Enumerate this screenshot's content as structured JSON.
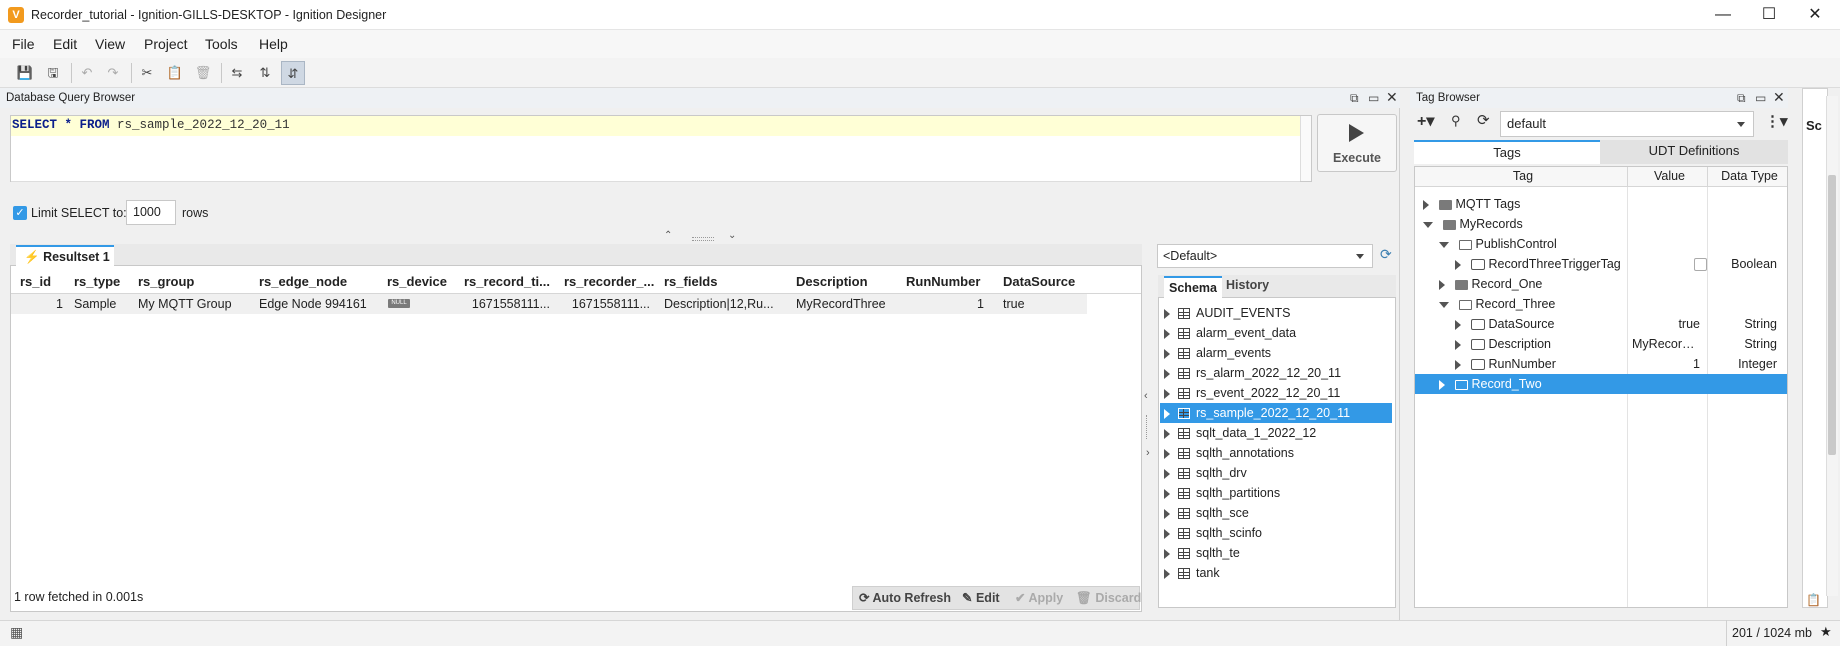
{
  "window": {
    "title": "Recorder_tutorial - Ignition-GILLS-DESKTOP - Ignition Designer",
    "app_icon": "V"
  },
  "menu": [
    "File",
    "Edit",
    "View",
    "Project",
    "Tools",
    "Help"
  ],
  "query_panel": {
    "title": "Database Query Browser",
    "sql_keyword1": "SELECT",
    "sql_star": " * ",
    "sql_keyword2": "FROM",
    "sql_table": " rs_sample_2022_12_20_11",
    "execute_label": "Execute",
    "limit_label": "Limit SELECT to:",
    "limit_value": "1000",
    "rows_label": "rows",
    "resultset_tab": "Resultset 1",
    "columns": [
      "rs_id",
      "rs_type",
      "rs_group",
      "rs_edge_node",
      "rs_device",
      "rs_record_ti...",
      "rs_recorder_...",
      "rs_fields",
      "Description",
      "RunNumber",
      "DataSource"
    ],
    "rows": [
      [
        "1",
        "Sample",
        "My MQTT Group",
        "Edge Node 994161",
        "NULL",
        "1671558111...",
        "1671558111...",
        "Description|12,Ru...",
        "MyRecordThree",
        "1",
        "true"
      ]
    ],
    "status": "1 row fetched in 0.001s",
    "auto_refresh": "Auto Refresh",
    "edit": "Edit",
    "apply": "Apply",
    "discard": "Discard"
  },
  "schema_panel": {
    "datasource": "<Default>",
    "tabs": [
      "Schema",
      "History"
    ],
    "tables": [
      "AUDIT_EVENTS",
      "alarm_event_data",
      "alarm_events",
      "rs_alarm_2022_12_20_11",
      "rs_event_2022_12_20_11",
      "rs_sample_2022_12_20_11",
      "sqlt_data_1_2022_12",
      "sqlth_annotations",
      "sqlth_drv",
      "sqlth_partitions",
      "sqlth_sce",
      "sqlth_scinfo",
      "sqlth_te",
      "tank"
    ],
    "selected_table": "rs_sample_2022_12_20_11"
  },
  "tag_browser": {
    "title": "Tag Browser",
    "provider": "default",
    "tabs": [
      "Tags",
      "UDT Definitions"
    ],
    "columns": [
      "Tag",
      "Value",
      "Data Type"
    ],
    "rows": [
      {
        "name": "MQTT Tags",
        "value": "",
        "type": ""
      },
      {
        "name": "MyRecords",
        "value": "",
        "type": ""
      },
      {
        "name": "PublishControl",
        "value": "",
        "type": ""
      },
      {
        "name": "RecordThreeTriggerTag",
        "value": "",
        "type": "Boolean"
      },
      {
        "name": "Record_One",
        "value": "",
        "type": ""
      },
      {
        "name": "Record_Three",
        "value": "",
        "type": ""
      },
      {
        "name": "DataSource",
        "value": "true",
        "type": "String"
      },
      {
        "name": "Description",
        "value": "MyRecordT...",
        "type": "String"
      },
      {
        "name": "RunNumber",
        "value": "1",
        "type": "Integer"
      },
      {
        "name": "Record_Two",
        "value": "",
        "type": ""
      }
    ]
  },
  "side_tab": "Sc",
  "statusbar": {
    "memory": "201 / 1024 mb"
  },
  "colors": {
    "accent": "#3399e6",
    "selected": "#3399e6",
    "editor_line": "#ffffd6"
  }
}
